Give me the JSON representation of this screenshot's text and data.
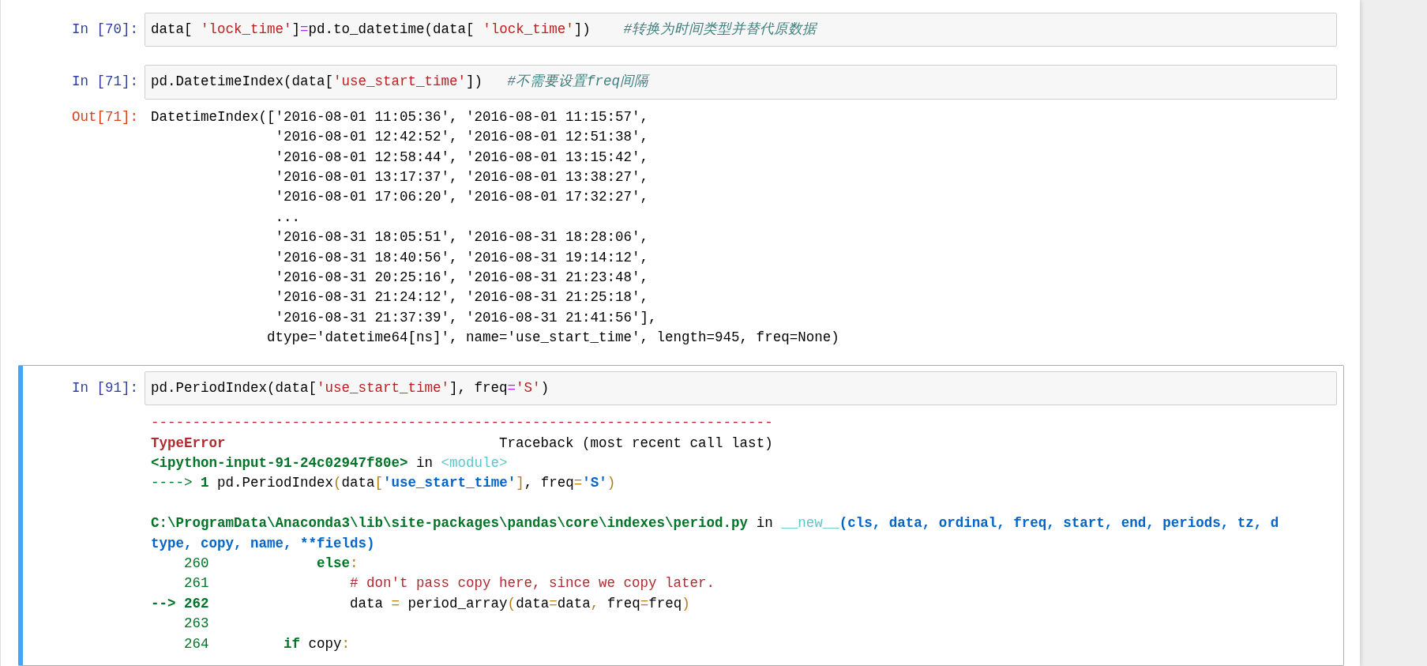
{
  "cells": [
    {
      "selected": false,
      "input": {
        "prompt": "In [70]:",
        "lines": [
          [
            {
              "text": "data[ ",
              "kind": "plain"
            },
            {
              "text": "'lock_time'",
              "kind": "string"
            },
            {
              "text": "]",
              "kind": "plain"
            },
            {
              "text": "=",
              "kind": "op"
            },
            {
              "text": "pd.to_datetime(data[ ",
              "kind": "plain"
            },
            {
              "text": "'lock_time'",
              "kind": "string"
            },
            {
              "text": "])    ",
              "kind": "plain"
            },
            {
              "text": "#转换为时间类型并替代原数据",
              "kind": "comment"
            }
          ]
        ]
      }
    },
    {
      "selected": false,
      "input": {
        "prompt": "In [71]:",
        "lines": [
          [
            {
              "text": "pd.DatetimeIndex(data[",
              "kind": "plain"
            },
            {
              "text": "'use_start_time'",
              "kind": "string"
            },
            {
              "text": "])   ",
              "kind": "plain"
            },
            {
              "text": "#不需要设置freq间隔",
              "kind": "comment"
            }
          ]
        ]
      },
      "output": {
        "prompt": "Out[71]:",
        "blocks": [
          [
            [
              {
                "text": "DatetimeIndex(['2016-08-01 11:05:36', '2016-08-01 11:15:57',",
                "kind": "plain"
              }
            ],
            [
              {
                "text": "               '2016-08-01 12:42:52', '2016-08-01 12:51:38',",
                "kind": "plain"
              }
            ],
            [
              {
                "text": "               '2016-08-01 12:58:44', '2016-08-01 13:15:42',",
                "kind": "plain"
              }
            ],
            [
              {
                "text": "               '2016-08-01 13:17:37', '2016-08-01 13:38:27',",
                "kind": "plain"
              }
            ],
            [
              {
                "text": "               '2016-08-01 17:06:20', '2016-08-01 17:32:27',",
                "kind": "plain"
              }
            ],
            [
              {
                "text": "               ...",
                "kind": "plain"
              }
            ],
            [
              {
                "text": "               '2016-08-31 18:05:51', '2016-08-31 18:28:06',",
                "kind": "plain"
              }
            ],
            [
              {
                "text": "               '2016-08-31 18:40:56', '2016-08-31 19:14:12',",
                "kind": "plain"
              }
            ],
            [
              {
                "text": "               '2016-08-31 20:25:16', '2016-08-31 21:23:48',",
                "kind": "plain"
              }
            ],
            [
              {
                "text": "               '2016-08-31 21:24:12', '2016-08-31 21:25:18',",
                "kind": "plain"
              }
            ],
            [
              {
                "text": "               '2016-08-31 21:37:39', '2016-08-31 21:41:56'],",
                "kind": "plain"
              }
            ],
            [
              {
                "text": "              dtype='datetime64[ns]', name='use_start_time', length=945, freq=None)",
                "kind": "plain"
              }
            ]
          ]
        ]
      }
    },
    {
      "selected": true,
      "input": {
        "prompt": "In [91]:",
        "lines": [
          [
            {
              "text": "pd.PeriodIndex(data[",
              "kind": "plain"
            },
            {
              "text": "'use_start_time'",
              "kind": "string"
            },
            {
              "text": "], freq",
              "kind": "plain"
            },
            {
              "text": "=",
              "kind": "op"
            },
            {
              "text": "'S'",
              "kind": "string"
            },
            {
              "text": ")",
              "kind": "plain"
            }
          ]
        ]
      },
      "output": {
        "blocks": [
          [
            [
              {
                "text": "---------------------------------------------------------------------------",
                "kind": "err"
              }
            ],
            [
              {
                "text": "TypeError",
                "kind": "err-bold"
              },
              {
                "text": "                                 Traceback (most recent call last)",
                "kind": "plain"
              }
            ],
            [
              {
                "text": "<ipython-input-91-24c02947f80e>",
                "kind": "green-bold"
              },
              {
                "text": " in ",
                "kind": "plain"
              },
              {
                "text": "<module>",
                "kind": "cyan"
              }
            ],
            [
              {
                "text": "----> ",
                "kind": "green"
              },
              {
                "text": "1",
                "kind": "green-bold"
              },
              {
                "text": " pd.PeriodIndex",
                "kind": "plain"
              },
              {
                "text": "(",
                "kind": "paren"
              },
              {
                "text": "data",
                "kind": "plain"
              },
              {
                "text": "[",
                "kind": "paren"
              },
              {
                "text": "'use_start_time'",
                "kind": "blue-bold"
              },
              {
                "text": "]",
                "kind": "paren"
              },
              {
                "text": ", freq",
                "kind": "plain"
              },
              {
                "text": "=",
                "kind": "paren"
              },
              {
                "text": "'S'",
                "kind": "blue-bold"
              },
              {
                "text": ")",
                "kind": "paren"
              }
            ]
          ],
          [
            [
              {
                "text": "C:\\ProgramData\\Anaconda3\\lib\\site-packages\\pandas\\core\\indexes\\period.py",
                "kind": "green-bold"
              },
              {
                "text": " in ",
                "kind": "plain"
              },
              {
                "text": "__new__",
                "kind": "cyan"
              },
              {
                "text": "(cls, data, ordinal, freq, start, end, periods, tz, d",
                "kind": "blue-bold"
              }
            ],
            [
              {
                "text": "type, copy, name, **fields)",
                "kind": "blue-bold"
              }
            ],
            [
              {
                "text": "    260",
                "kind": "green"
              },
              {
                "text": "             else",
                "kind": "keyword"
              },
              {
                "text": ":",
                "kind": "paren"
              }
            ],
            [
              {
                "text": "    261",
                "kind": "green"
              },
              {
                "text": "                 # don't pass copy here, since we copy later.",
                "kind": "err"
              }
            ],
            [
              {
                "text": "--> 262",
                "kind": "green-bold"
              },
              {
                "text": "                 data ",
                "kind": "plain"
              },
              {
                "text": "=",
                "kind": "paren"
              },
              {
                "text": " period_array",
                "kind": "plain"
              },
              {
                "text": "(",
                "kind": "paren"
              },
              {
                "text": "data",
                "kind": "plain"
              },
              {
                "text": "=",
                "kind": "paren"
              },
              {
                "text": "data",
                "kind": "plain"
              },
              {
                "text": ",",
                "kind": "paren"
              },
              {
                "text": " freq",
                "kind": "plain"
              },
              {
                "text": "=",
                "kind": "paren"
              },
              {
                "text": "freq",
                "kind": "plain"
              },
              {
                "text": ")",
                "kind": "paren"
              }
            ],
            [
              {
                "text": "    263",
                "kind": "green"
              }
            ],
            [
              {
                "text": "    264",
                "kind": "green"
              },
              {
                "text": "         if",
                "kind": "keyword"
              },
              {
                "text": " copy",
                "kind": "plain"
              },
              {
                "text": ":",
                "kind": "paren"
              }
            ]
          ]
        ]
      }
    }
  ]
}
